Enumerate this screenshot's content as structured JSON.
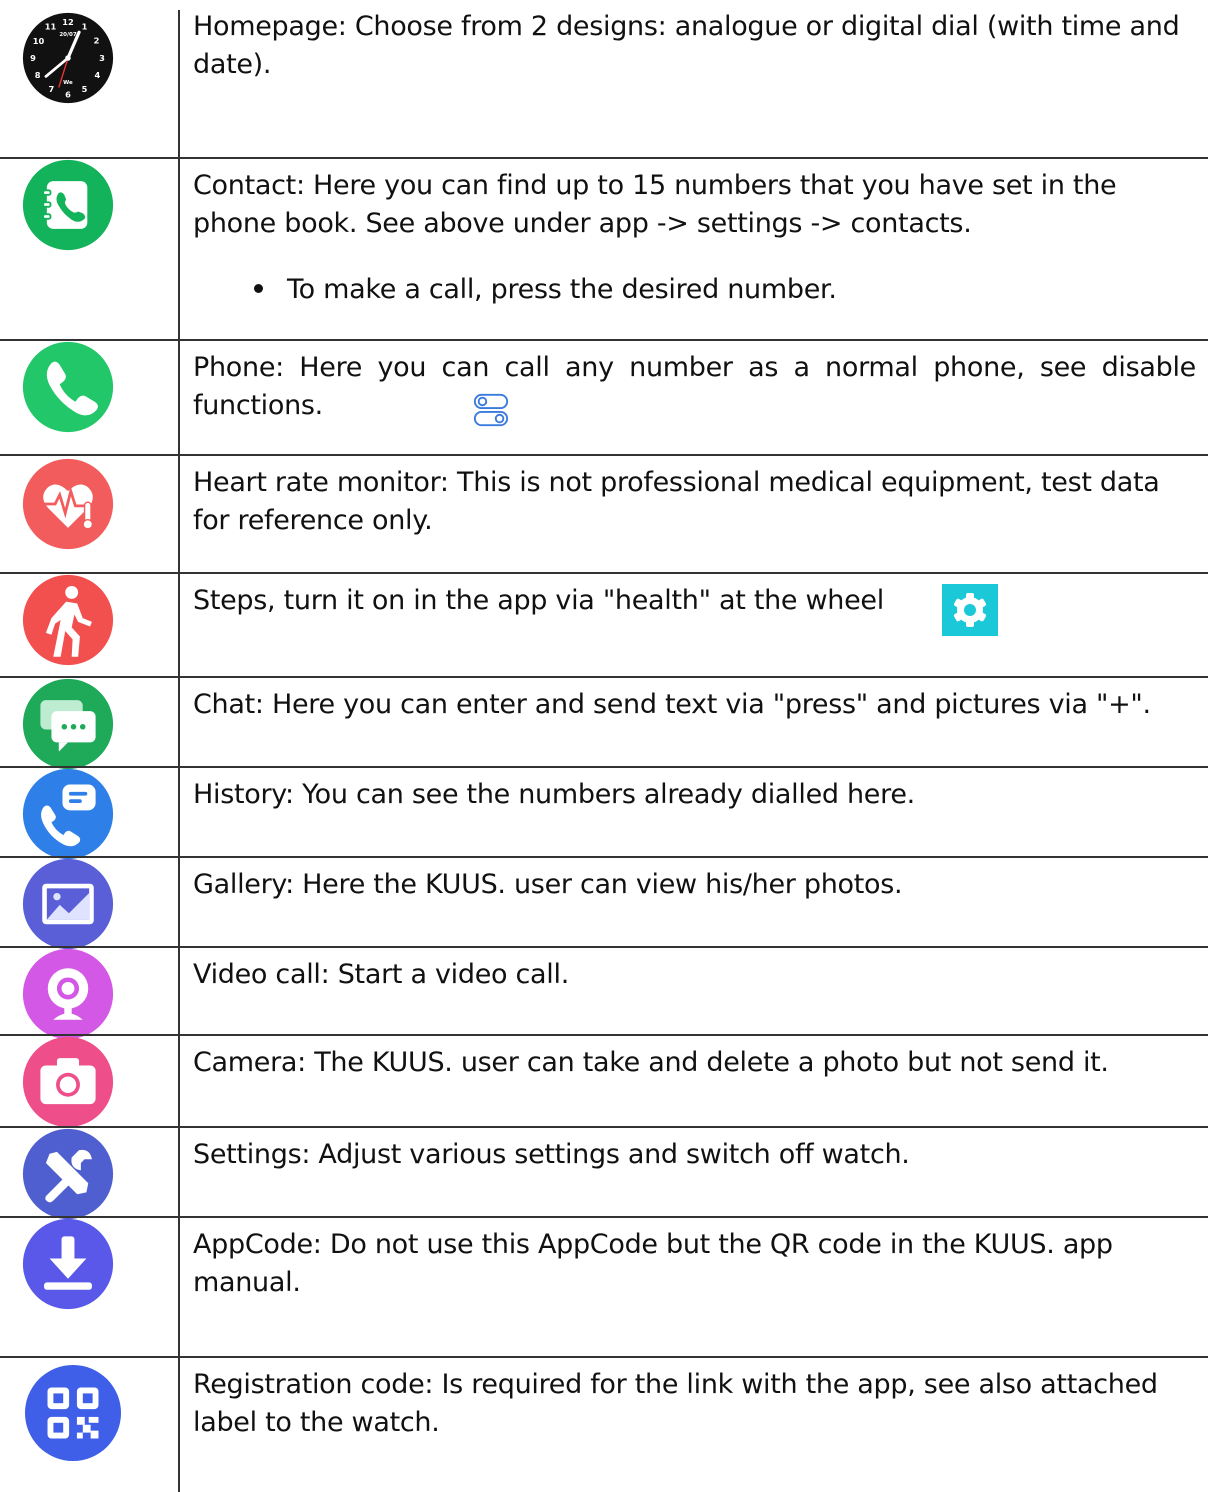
{
  "rows": [
    {
      "icon": "analog-clock-icon",
      "text": "Homepage: Choose from 2 designs: analogue or digital dial (with time and date).",
      "clock": {
        "numbers": [
          "12",
          "1",
          "2",
          "3",
          "4",
          "5",
          "6",
          "7",
          "8",
          "9",
          "10",
          "11"
        ],
        "date": "20/07",
        "day": "We"
      }
    },
    {
      "icon": "contacts-book-icon",
      "text": "Contact: Here you can find up to 15 numbers that you have set in the phone book. See above under app -> settings -> contacts.",
      "bullet": "To make a call, press the desired number."
    },
    {
      "icon": "phone-icon",
      "text": "Phone: Here you can call any number as a normal phone, see disable functions."
    },
    {
      "icon": "heart-rate-icon",
      "text": "Heart rate monitor: This is not professional medical equipment, test data for reference only."
    },
    {
      "icon": "walking-person-icon",
      "text": "Steps, turn it on in the app via \"health\" at the wheel"
    },
    {
      "icon": "chat-bubbles-icon",
      "text": "Chat: Here you can enter and send text via \"press\" and pictures via \"+\"."
    },
    {
      "icon": "call-history-icon",
      "text": "History: You can see the numbers already dialled here."
    },
    {
      "icon": "gallery-icon",
      "text": "Gallery: Here the KUUS. user can view his/her photos."
    },
    {
      "icon": "webcam-icon",
      "text": "Video call: Start a video call."
    },
    {
      "icon": "camera-icon",
      "text": "Camera: The KUUS. user can take and delete a photo but not send it."
    },
    {
      "icon": "tools-icon",
      "text": "Settings: Adjust various settings and switch off watch."
    },
    {
      "icon": "download-icon",
      "text": "AppCode: Do not use this AppCode but the QR code in the KUUS. app manual."
    },
    {
      "icon": "qr-code-icon",
      "text": "Registration code: Is required for the link with the app, see also attached label to the watch."
    }
  ],
  "inline_icons": {
    "toggle": "toggle-switch-icon",
    "gear": "gear-icon"
  },
  "colors": {
    "contact": "#12b35a",
    "phone": "#22c76a",
    "heart": "#f25c5c",
    "steps": "#f2504f",
    "chat": "#1faa5a",
    "history": "#2f7fe8",
    "gallery": "#5a5fd8",
    "video": "#d458e6",
    "camera": "#ee4f8a",
    "settings": "#4f5fd0",
    "download": "#5a58e8",
    "qr": "#3f5fe8",
    "gear": "#1ac8d8"
  }
}
